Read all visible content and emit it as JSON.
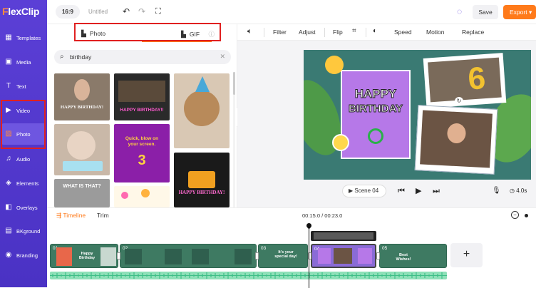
{
  "sidebar": {
    "logo": {
      "first": "F",
      "rest": "lexClip"
    },
    "items": [
      {
        "label": "Templates",
        "icon": "templates-icon"
      },
      {
        "label": "Media",
        "icon": "media-icon"
      },
      {
        "label": "Text",
        "icon": "text-icon"
      },
      {
        "label": "Video",
        "icon": "video-icon"
      },
      {
        "label": "Photo",
        "icon": "photo-icon",
        "active": true
      },
      {
        "label": "Audio",
        "icon": "audio-icon"
      },
      {
        "label": "Elements",
        "icon": "elements-icon"
      },
      {
        "label": "Overlays",
        "icon": "overlays-icon"
      },
      {
        "label": "BKground",
        "icon": "background-icon"
      },
      {
        "label": "Branding",
        "icon": "branding-icon"
      }
    ]
  },
  "topbar": {
    "ratio": "16:9",
    "title": "Untitled",
    "save_label": "Save",
    "export_label": "Export"
  },
  "panel": {
    "tabs": [
      {
        "label": "Photo",
        "icon": "photo-tab-icon"
      },
      {
        "label": "GIF",
        "icon": "gif-tab-icon",
        "active": true
      }
    ],
    "search": {
      "value": "birthday",
      "placeholder": ""
    },
    "thumbs": [
      {
        "caption": "HAPPY BIRTHDAY!"
      },
      {
        "caption": "HAPPY BIRTHDAY!!"
      },
      {
        "caption": ""
      },
      {
        "caption": ""
      },
      {
        "caption": "Quick, blow on your screen.",
        "number": "3"
      },
      {
        "caption": "HAPPY BIRTHDAY!"
      },
      {
        "caption": "WHAT IS THAT?"
      },
      {
        "caption": ""
      }
    ]
  },
  "edit_toolbar": {
    "items": [
      "Filter",
      "Adjust",
      "Flip",
      "Speed",
      "Motion",
      "Replace"
    ]
  },
  "canvas": {
    "card_line1": "HAPPY",
    "card_line2": "BIRTHDAY",
    "number": "6"
  },
  "player": {
    "scene_label": "Scene 04",
    "duration": "4.0s"
  },
  "timeline": {
    "tabs": [
      "Timeline",
      "Trim"
    ],
    "current_time": "00:15.0",
    "total_time": "00:23.0",
    "clips": [
      {
        "num": "01"
      },
      {
        "num": "02"
      },
      {
        "num": "03"
      },
      {
        "num": "04"
      },
      {
        "num": "05"
      }
    ],
    "clip_texts": [
      "Happy Birthday",
      "It's your special day!",
      "Best Wishes!"
    ]
  },
  "colors": {
    "sidebar": "#4a32c4",
    "accent": "#ff7a1a",
    "highlight_box": "#e02020",
    "canvas_bg": "#3a7a73",
    "card": "#b678e8"
  }
}
